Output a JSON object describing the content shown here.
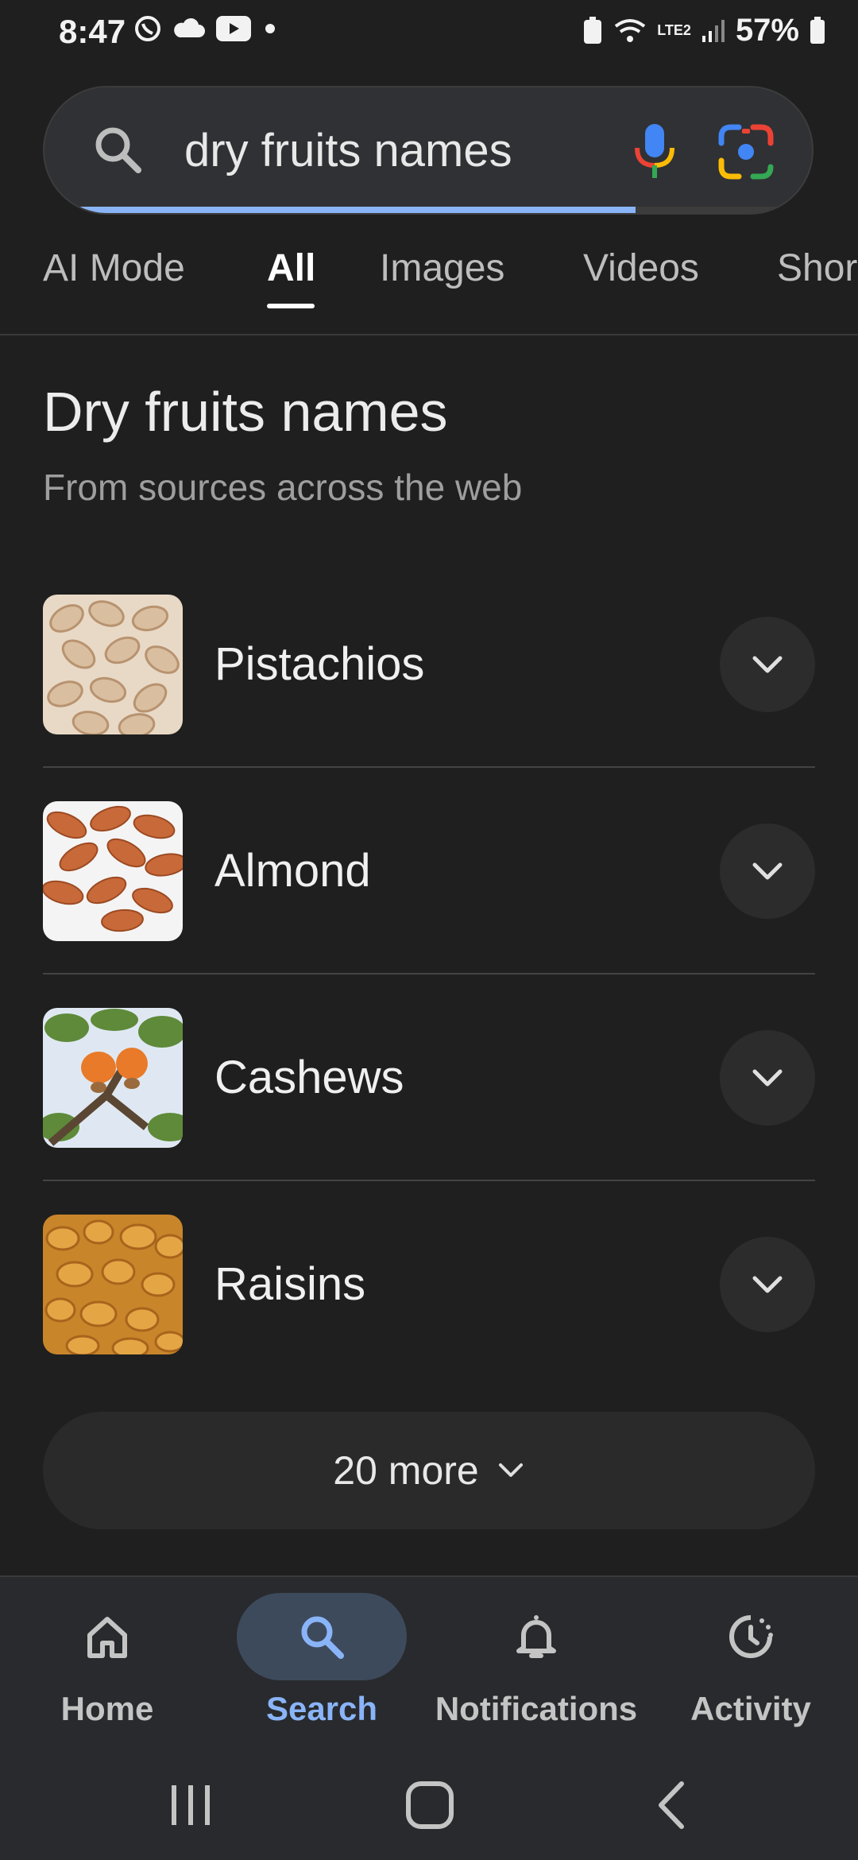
{
  "status": {
    "time": "8:47",
    "battery": "57%",
    "network": "LTE2"
  },
  "search": {
    "query": "dry fruits names",
    "progress": 0.77
  },
  "tabs": [
    {
      "label": "AI Mode"
    },
    {
      "label": "All"
    },
    {
      "label": "Images"
    },
    {
      "label": "Videos"
    },
    {
      "label": "Shor"
    }
  ],
  "result": {
    "title": "Dry fruits names",
    "subtitle": "From sources across the web",
    "items": [
      {
        "label": "Pistachios"
      },
      {
        "label": "Almond"
      },
      {
        "label": "Cashews"
      },
      {
        "label": "Raisins"
      }
    ],
    "more_label": "20 more"
  },
  "bottom_nav": [
    {
      "label": "Home"
    },
    {
      "label": "Search"
    },
    {
      "label": "Notifications"
    },
    {
      "label": "Activity"
    }
  ],
  "colors": {
    "background": "#1f1f1f",
    "accent": "#8ab4f8"
  }
}
